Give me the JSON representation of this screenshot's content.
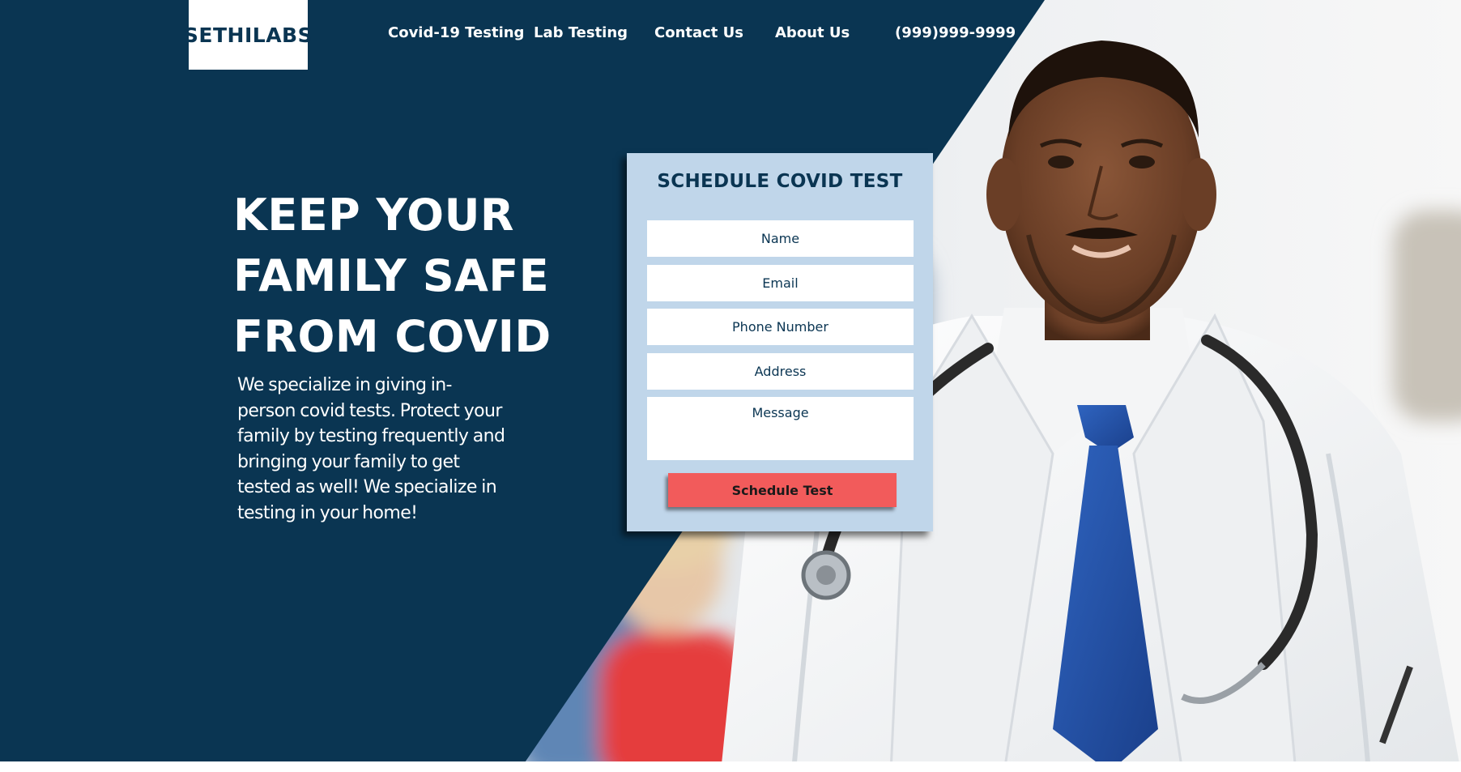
{
  "brand": {
    "logo_text": "SETHILABS"
  },
  "nav": {
    "items": [
      {
        "label": "Covid-19 Testing"
      },
      {
        "label": "Lab Testing"
      },
      {
        "label": "Contact Us"
      },
      {
        "label": "About Us"
      },
      {
        "label": "(999)999-9999"
      }
    ]
  },
  "hero": {
    "heading_lines": [
      "KEEP YOUR",
      "FAMILY SAFE",
      "FROM COVID"
    ],
    "body": "We specialize in giving in-person covid tests. Protect your family by testing frequently and bringing your family to get tested as well! We specialize in testing in your home!"
  },
  "form": {
    "title": "SCHEDULE COVID TEST",
    "name_placeholder": "Name",
    "email_placeholder": "Email",
    "phone_placeholder": "Phone Number",
    "address_placeholder": "Address",
    "message_placeholder": "Message",
    "submit_label": "Schedule Test"
  },
  "colors": {
    "navy": "#0a3552",
    "form_background": "#c0d6ea",
    "button": "#f25b5b",
    "white": "#ffffff"
  }
}
